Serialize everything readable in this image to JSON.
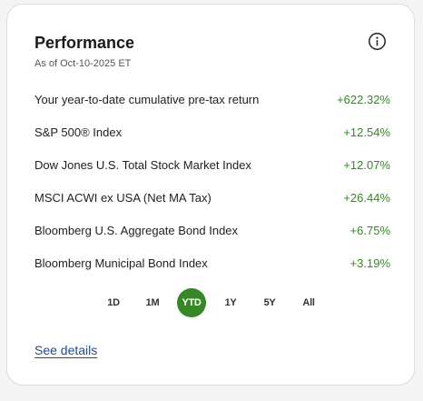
{
  "card": {
    "title": "Performance",
    "as_of": "As of Oct-10-2025 ET",
    "info_icon": "info-circle-icon"
  },
  "rows": [
    {
      "label": "Your year-to-date cumulative pre-tax return",
      "value": "+622.32%"
    },
    {
      "label": "S&P 500® Index",
      "value": "+12.54%"
    },
    {
      "label": "Dow Jones U.S. Total Stock Market Index",
      "value": "+12.07%"
    },
    {
      "label": "MSCI ACWI ex USA (Net MA Tax)",
      "value": "+26.44%"
    },
    {
      "label": "Bloomberg U.S. Aggregate Bond Index",
      "value": "+6.75%"
    },
    {
      "label": "Bloomberg Municipal Bond Index",
      "value": "+3.19%"
    }
  ],
  "periods": {
    "options": [
      "1D",
      "1M",
      "YTD",
      "1Y",
      "5Y",
      "All"
    ],
    "selected": "YTD"
  },
  "links": {
    "see_details": "See details"
  },
  "colors": {
    "positive": "#368727",
    "accent": "#368727",
    "link": "#1e4b8c"
  }
}
